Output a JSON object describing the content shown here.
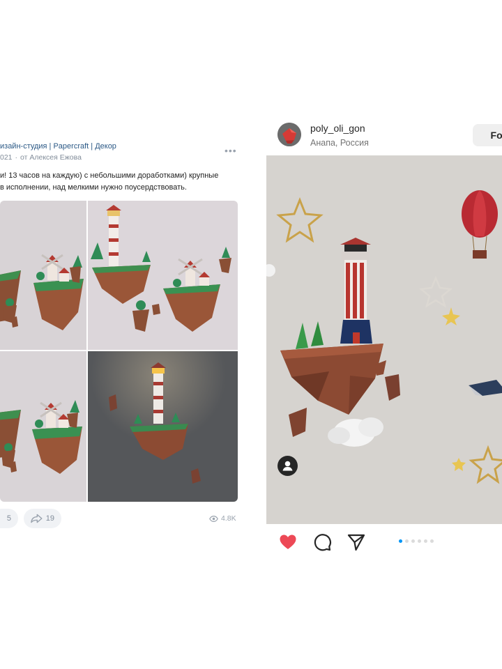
{
  "vk_post": {
    "community": "изайн-студия | Papercraft | Декор",
    "date": "021",
    "author": "от Алексея Ежова",
    "more_icon": "ellipsis-icon",
    "text_line1": "и! 13 часов на каждую) с небольшими доработками) крупные",
    "text_line2": "в исполнении, над мелкими нужно поусердствовать.",
    "likes": "5",
    "shares": "19",
    "views": "4.8K",
    "icons": {
      "like": "heart-icon",
      "share": "share-icon",
      "views": "eye-icon"
    }
  },
  "ig_post": {
    "username": "poly_oli_gon",
    "location": "Анапа, Россия",
    "follow_label": "Foll",
    "icons": {
      "like": "heart-filled-icon",
      "comment": "comment-icon",
      "share": "send-icon",
      "tag": "user-tag-icon"
    },
    "carousel": {
      "total": 6,
      "active": 1
    },
    "like_color": "#ed4956"
  },
  "colors": {
    "vk_link": "#2a5885",
    "vk_meta": "#818c99",
    "ig_blue": "#0095f6"
  }
}
